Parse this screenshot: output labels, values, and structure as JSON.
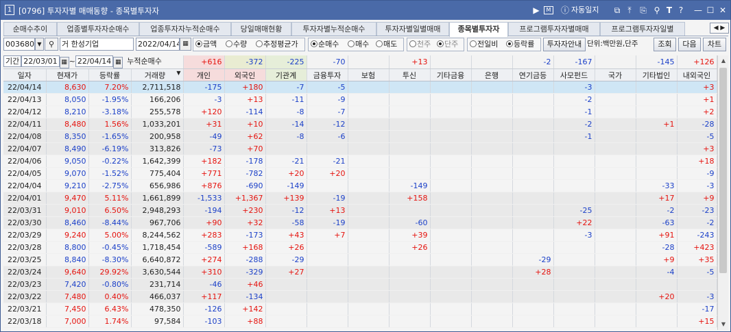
{
  "window": {
    "screen_no": "1",
    "title": "[0796] 투자자별 매매동향 - 종목별투자자",
    "diary_label": "자동일지"
  },
  "tabs": [
    {
      "label": "순매수추이",
      "active": false
    },
    {
      "label": "업종별투자자순매수",
      "active": false
    },
    {
      "label": "업종투자자누적순매수",
      "active": false
    },
    {
      "label": "당일매매현황",
      "active": false
    },
    {
      "label": "투자자별누적순매수",
      "active": false
    },
    {
      "label": "투자자별일별매매",
      "active": false
    },
    {
      "label": "종목별투자자",
      "active": true
    },
    {
      "label": "프로그램투자자별매매",
      "active": false
    },
    {
      "label": "프로그램투자자일별",
      "active": false
    }
  ],
  "toolbar": {
    "stock_code": "003680",
    "market_tag": "거",
    "stock_name": "한성기업",
    "date": "2022/04/14",
    "unit_radios": [
      {
        "label": "금액",
        "on": true
      },
      {
        "label": "수량",
        "on": false
      },
      {
        "label": "추정평균가",
        "on": false
      }
    ],
    "trade_radios": [
      {
        "label": "순매수",
        "on": true
      },
      {
        "label": "매수",
        "on": false
      },
      {
        "label": "매도",
        "on": false
      }
    ],
    "share_radios": [
      {
        "label": "천주",
        "on": false
      },
      {
        "label": "단주",
        "on": true
      }
    ],
    "compare_radios": [
      {
        "label": "전일비",
        "on": false
      },
      {
        "label": "등락률",
        "on": true
      }
    ],
    "guide_button": "투자자안내",
    "unit_text": "단위:백만원,단주",
    "query_button": "조회",
    "next_button": "다음",
    "chart_button": "차트"
  },
  "period": {
    "label": "기간",
    "from": "22/03/01",
    "tilde": "~",
    "to": "22/04/14",
    "cumulative_label": "누적순매수"
  },
  "summary": [
    "",
    "",
    "",
    "",
    "+616",
    "-372",
    "-225",
    "-70",
    "",
    "+13",
    "",
    "",
    "-2",
    "-167",
    "",
    "-145",
    "+126"
  ],
  "columns": [
    "일자",
    "현재가",
    "등락률",
    "거래량",
    "개인",
    "외국인",
    "기관계",
    "금융투자",
    "보험",
    "투신",
    "기타금융",
    "은행",
    "연기금등",
    "사모펀드",
    "국가",
    "기타법인",
    "내외국인"
  ],
  "rows": [
    [
      "22/04/14",
      "8,630",
      "7.20%",
      "2,711,518",
      "-175",
      "+180",
      "-7",
      "-5",
      "",
      "",
      "",
      "",
      "",
      "-3",
      "",
      "",
      "+3"
    ],
    [
      "22/04/13",
      "8,050",
      "-1.95%",
      "166,206",
      "-3",
      "+13",
      "-11",
      "-9",
      "",
      "",
      "",
      "",
      "",
      "-2",
      "",
      "",
      "+1"
    ],
    [
      "22/04/12",
      "8,210",
      "-3.18%",
      "255,578",
      "+120",
      "-114",
      "-8",
      "-7",
      "",
      "",
      "",
      "",
      "",
      "-1",
      "",
      "",
      "+2"
    ],
    [
      "22/04/11",
      "8,480",
      "1.56%",
      "1,033,201",
      "+31",
      "+10",
      "-14",
      "-12",
      "",
      "",
      "",
      "",
      "",
      "-2",
      "",
      "+1",
      "-28"
    ],
    [
      "22/04/08",
      "8,350",
      "-1.65%",
      "200,958",
      "-49",
      "+62",
      "-8",
      "-6",
      "",
      "",
      "",
      "",
      "",
      "-1",
      "",
      "",
      "-5"
    ],
    [
      "22/04/07",
      "8,490",
      "-6.19%",
      "313,826",
      "-73",
      "+70",
      "",
      "",
      "",
      "",
      "",
      "",
      "",
      "",
      "",
      "",
      "+3"
    ],
    [
      "22/04/06",
      "9,050",
      "-0.22%",
      "1,642,399",
      "+182",
      "-178",
      "-21",
      "-21",
      "",
      "",
      "",
      "",
      "",
      "",
      "",
      "",
      "+18"
    ],
    [
      "22/04/05",
      "9,070",
      "-1.52%",
      "775,404",
      "+771",
      "-782",
      "+20",
      "+20",
      "",
      "",
      "",
      "",
      "",
      "",
      "",
      "",
      "-9"
    ],
    [
      "22/04/04",
      "9,210",
      "-2.75%",
      "656,986",
      "+876",
      "-690",
      "-149",
      "",
      "",
      "-149",
      "",
      "",
      "",
      "",
      "",
      "-33",
      "-3"
    ],
    [
      "22/04/01",
      "9,470",
      "5.11%",
      "1,661,899",
      "-1,533",
      "+1,367",
      "+139",
      "-19",
      "",
      "+158",
      "",
      "",
      "",
      "",
      "",
      "+17",
      "+9"
    ],
    [
      "22/03/31",
      "9,010",
      "6.50%",
      "2,948,293",
      "-194",
      "+230",
      "-12",
      "+13",
      "",
      "",
      "",
      "",
      "",
      "-25",
      "",
      "-2",
      "-23"
    ],
    [
      "22/03/30",
      "8,460",
      "-8.44%",
      "967,706",
      "+90",
      "+32",
      "-58",
      "-19",
      "",
      "-60",
      "",
      "",
      "",
      "+22",
      "",
      "-63",
      "-2"
    ],
    [
      "22/03/29",
      "9,240",
      "5.00%",
      "8,244,562",
      "+283",
      "-173",
      "+43",
      "+7",
      "",
      "+39",
      "",
      "",
      "",
      "-3",
      "",
      "+91",
      "-243"
    ],
    [
      "22/03/28",
      "8,800",
      "-0.45%",
      "1,718,454",
      "-589",
      "+168",
      "+26",
      "",
      "",
      "+26",
      "",
      "",
      "",
      "",
      "",
      "-28",
      "+423"
    ],
    [
      "22/03/25",
      "8,840",
      "-8.30%",
      "6,640,872",
      "+274",
      "-288",
      "-29",
      "",
      "",
      "",
      "",
      "",
      "-29",
      "",
      "",
      "+9",
      "+35"
    ],
    [
      "22/03/24",
      "9,640",
      "29.92%",
      "3,630,544",
      "+310",
      "-329",
      "+27",
      "",
      "",
      "",
      "",
      "",
      "+28",
      "",
      "",
      "-4",
      "-5"
    ],
    [
      "22/03/23",
      "7,420",
      "-0.80%",
      "231,714",
      "-46",
      "+46",
      "",
      "",
      "",
      "",
      "",
      "",
      "",
      "",
      "",
      "",
      ""
    ],
    [
      "22/03/22",
      "7,480",
      "0.40%",
      "466,037",
      "+117",
      "-134",
      "",
      "",
      "",
      "",
      "",
      "",
      "",
      "",
      "",
      "+20",
      "-3"
    ],
    [
      "22/03/21",
      "7,450",
      "6.43%",
      "478,350",
      "-126",
      "+142",
      "",
      "",
      "",
      "",
      "",
      "",
      "",
      "",
      "",
      "",
      "-17"
    ],
    [
      "22/03/18",
      "7,000",
      "1.74%",
      "97,584",
      "-103",
      "+88",
      "",
      "",
      "",
      "",
      "",
      "",
      "",
      "",
      "",
      "",
      "+15"
    ]
  ],
  "colors": {
    "up": "#e5120d",
    "down": "#1a3fc8",
    "selected_row": "#cfe6f5",
    "title_bar": "#4a6aa8"
  }
}
